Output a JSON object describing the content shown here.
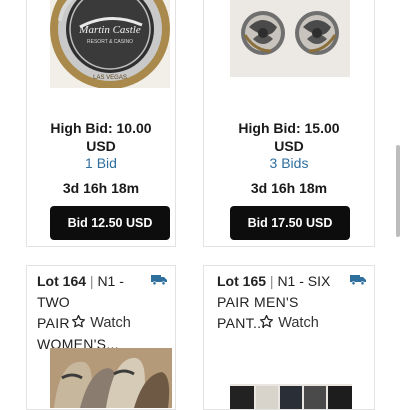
{
  "cards_top": [
    {
      "image_alt": "Martin Castle coin",
      "high_bid": "High Bid: 10.00",
      "currency": "USD",
      "bids": "1 Bid",
      "time_left": "3d 16h 18m",
      "button": "Bid 12.50 USD"
    },
    {
      "image_alt": "Rose earrings",
      "high_bid": "High Bid: 15.00",
      "currency": "USD",
      "bids": "3 Bids",
      "time_left": "3d 16h 18m",
      "button": "Bid 17.50 USD"
    }
  ],
  "cards_bottom": [
    {
      "lot": "Lot 164",
      "title_line1": "N1 - TWO",
      "title_line2": "PAIR WOMEN'S...",
      "watch": "Watch",
      "shipping_icon": "truck-icon"
    },
    {
      "lot": "Lot 165",
      "title_line1": "N1 - SIX",
      "title_line2": "PAIR MEN'S PANT...",
      "watch": "Watch",
      "shipping_icon": "truck-icon"
    }
  ],
  "coin_text": {
    "brand": "Martin Castle",
    "sub": "RESORT & CASINO",
    "ring": "LIMITED EDITION"
  },
  "colors": {
    "link_blue": "#2f6f9e",
    "button_black": "#0d0d0d",
    "truck_blue": "#2f6f9e"
  }
}
